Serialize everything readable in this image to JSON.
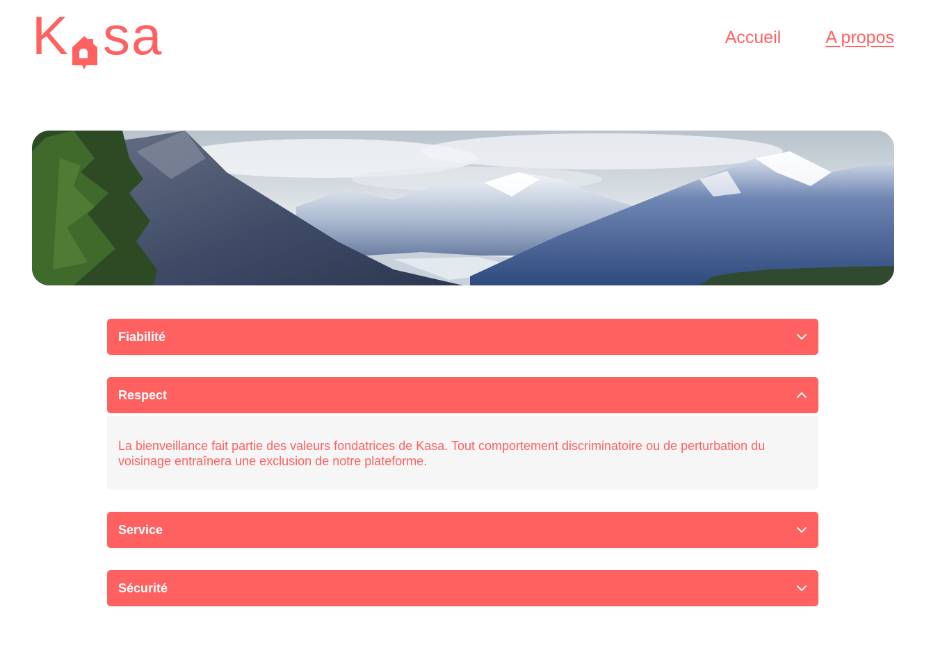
{
  "brand": {
    "name_start": "K",
    "name_end": "sa",
    "accent": "#FF6060"
  },
  "nav": {
    "items": [
      {
        "label": "Accueil",
        "active": false
      },
      {
        "label": "A propos",
        "active": true
      }
    ]
  },
  "banner": {
    "icon": "mountain-landscape-image"
  },
  "collapses": [
    {
      "title": "Fiabilité",
      "expanded": false,
      "icon": "chevron-down-icon"
    },
    {
      "title": "Respect",
      "expanded": true,
      "icon": "chevron-up-icon",
      "content": "La bienveillance fait partie des valeurs fondatrices de Kasa. Tout comportement discriminatoire ou de perturbation du voisinage entraînera une exclusion de notre plateforme."
    },
    {
      "title": "Service",
      "expanded": false,
      "icon": "chevron-down-icon"
    },
    {
      "title": "Sécurité",
      "expanded": false,
      "icon": "chevron-down-icon"
    }
  ],
  "colors": {
    "accent": "#FF6060",
    "panel_bg": "#F6F6F6",
    "text_on_accent": "#FFFFFF"
  }
}
